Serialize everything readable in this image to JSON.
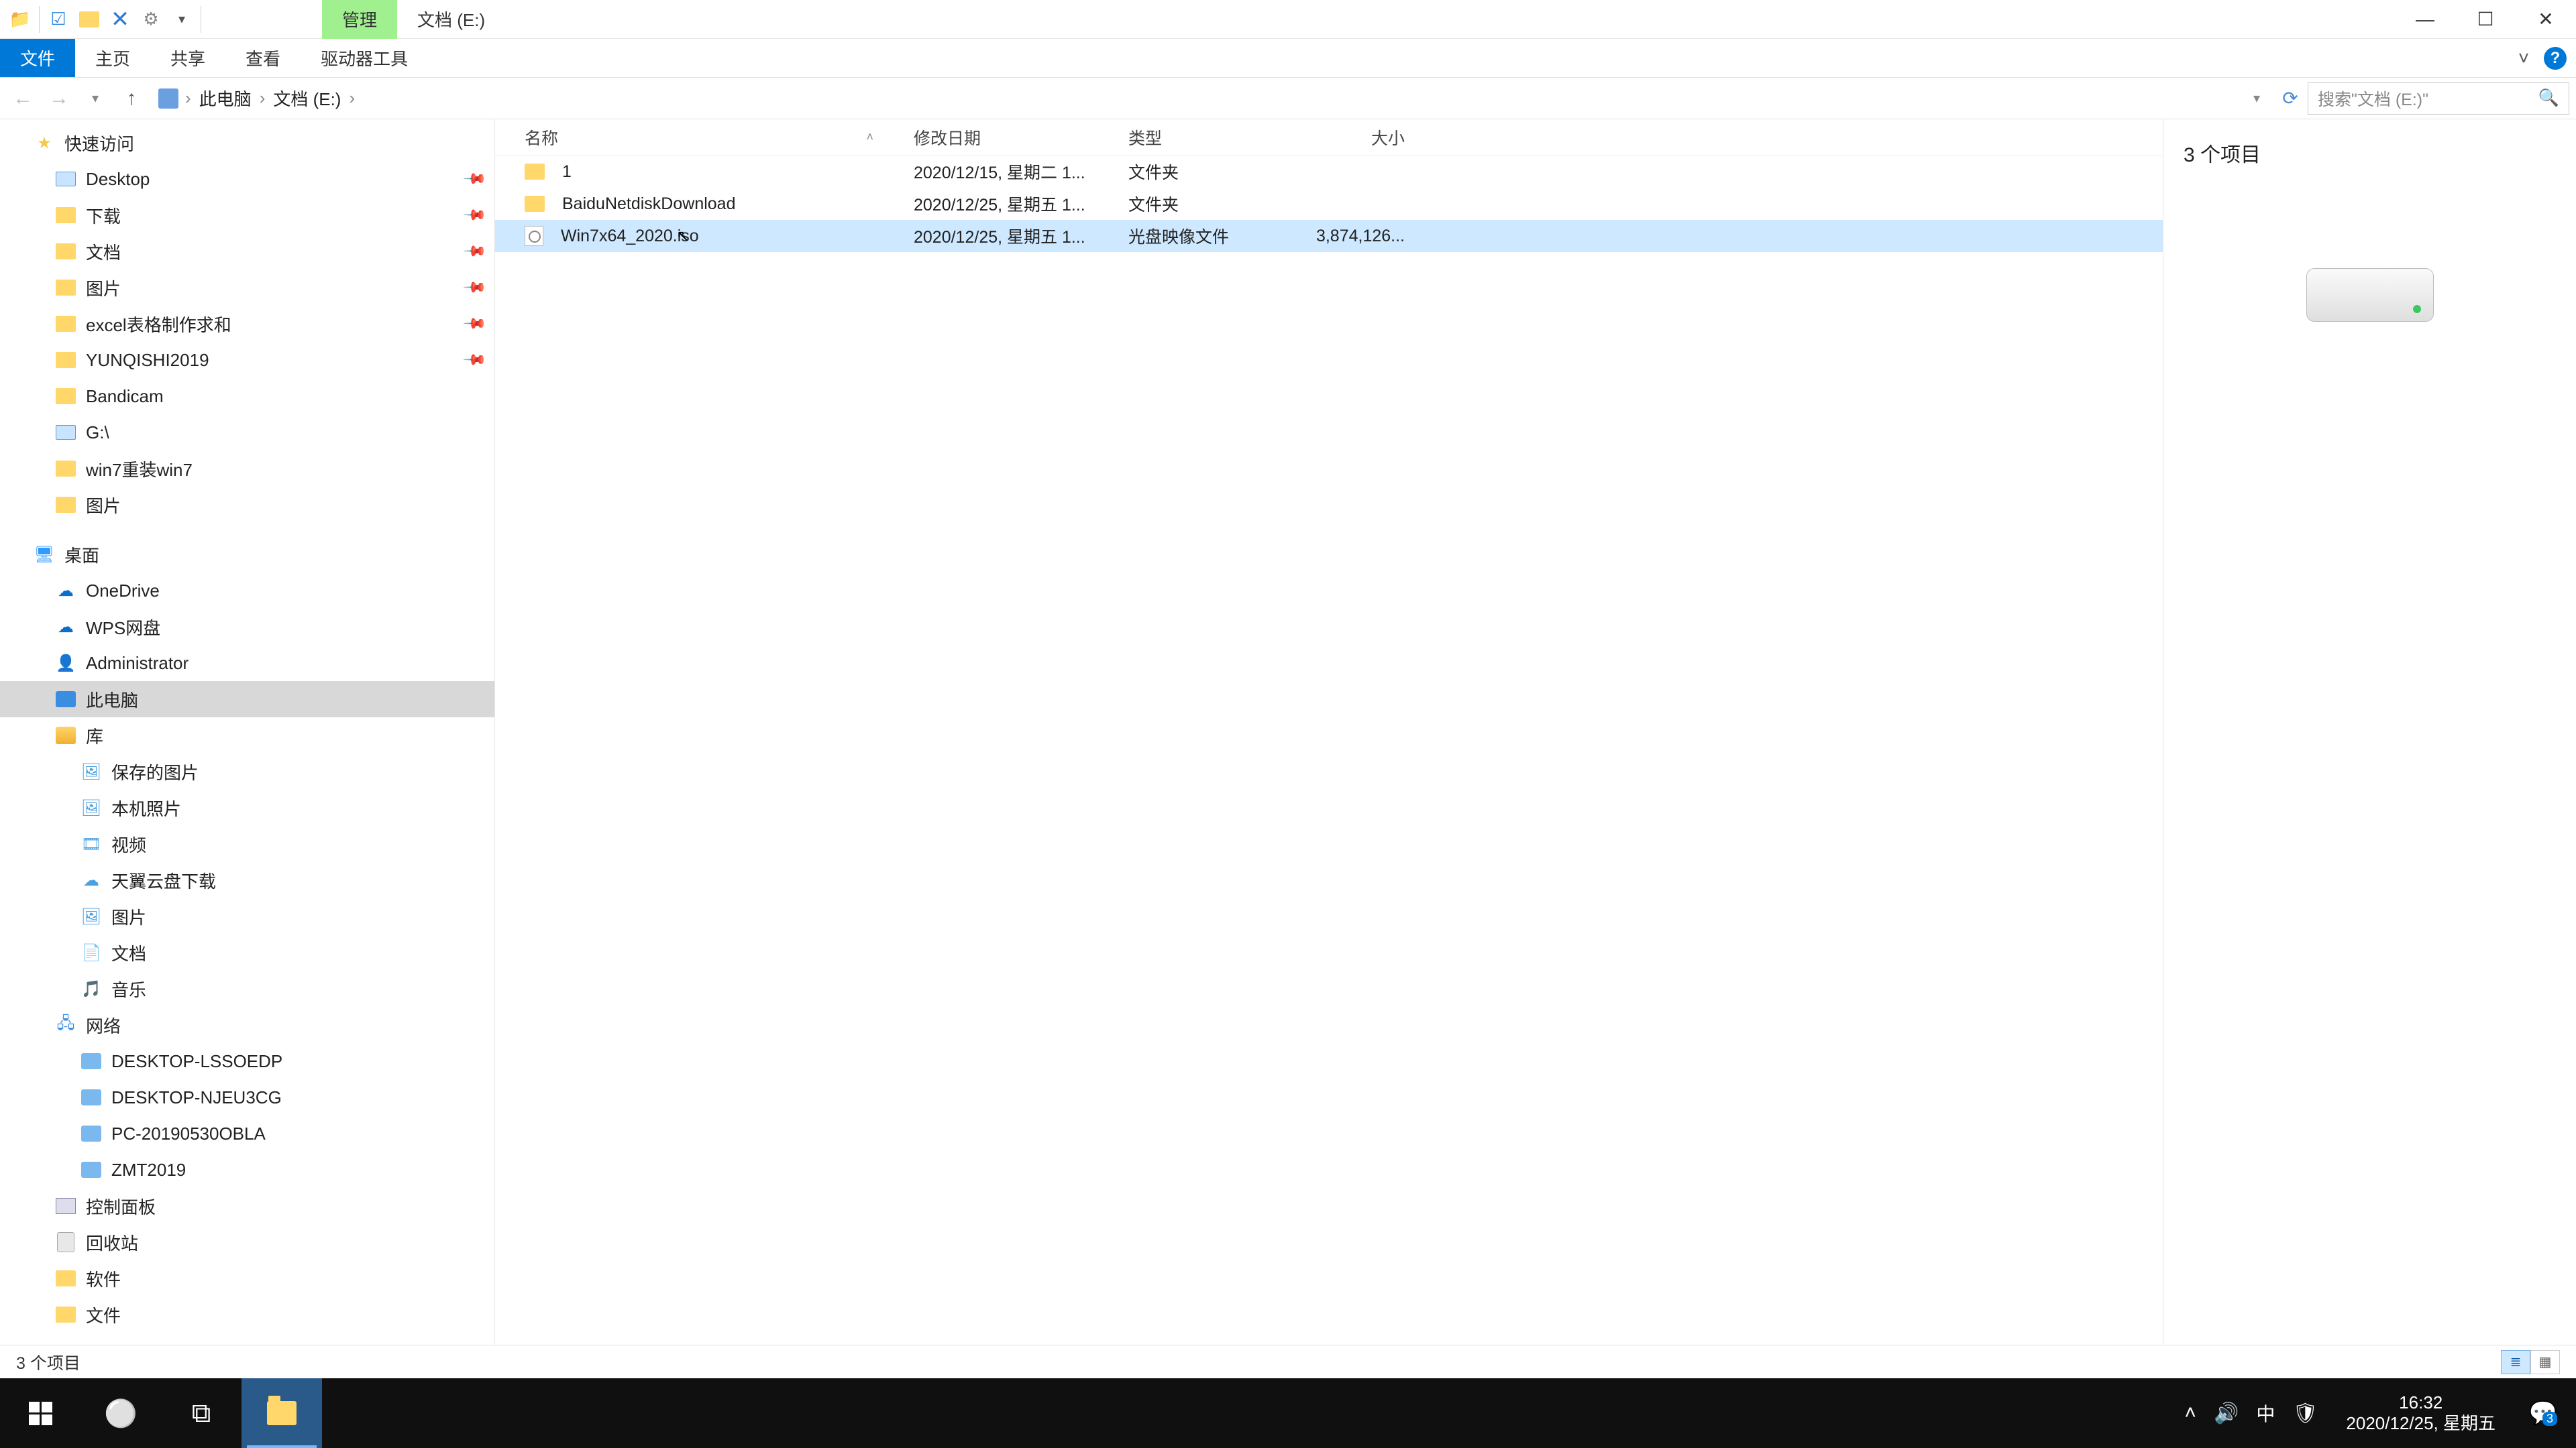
{
  "titlebar": {
    "context_tab": "管理",
    "title_tab": "文档 (E:)"
  },
  "ribbon": {
    "file": "文件",
    "tabs": [
      "主页",
      "共享",
      "查看",
      "驱动器工具"
    ]
  },
  "breadcrumb": {
    "items": [
      "此电脑",
      "文档 (E:)"
    ]
  },
  "search": {
    "placeholder": "搜索\"文档 (E:)\""
  },
  "sidebar": {
    "quick_access": "快速访问",
    "qa_items": [
      {
        "label": "Desktop",
        "icon": "drive",
        "pinned": true
      },
      {
        "label": "下载",
        "icon": "folder",
        "pinned": true
      },
      {
        "label": "文档",
        "icon": "folder",
        "pinned": true
      },
      {
        "label": "图片",
        "icon": "folder",
        "pinned": true
      },
      {
        "label": "excel表格制作求和",
        "icon": "folder",
        "pinned": true
      },
      {
        "label": "YUNQISHI2019",
        "icon": "folder",
        "pinned": true
      },
      {
        "label": "Bandicam",
        "icon": "folder",
        "pinned": false
      },
      {
        "label": "G:\\",
        "icon": "drive",
        "pinned": false
      },
      {
        "label": "win7重装win7",
        "icon": "folder",
        "pinned": false
      },
      {
        "label": "图片",
        "icon": "folder",
        "pinned": false
      }
    ],
    "desktop": "桌面",
    "desktop_items": [
      {
        "label": "OneDrive",
        "icon": "onedrive"
      },
      {
        "label": "WPS网盘",
        "icon": "onedrive"
      },
      {
        "label": "Administrator",
        "icon": "user"
      },
      {
        "label": "此电脑",
        "icon": "pc",
        "selected": true
      },
      {
        "label": "库",
        "icon": "lib"
      }
    ],
    "lib_items": [
      "保存的图片",
      "本机照片",
      "视频",
      "天翼云盘下载",
      "图片",
      "文档",
      "音乐"
    ],
    "network": "网络",
    "net_items": [
      "DESKTOP-LSSOEDP",
      "DESKTOP-NJEU3CG",
      "PC-20190530OBLA",
      "ZMT2019"
    ],
    "control_panel": "控制面板",
    "recycle": "回收站",
    "software": "软件",
    "docs": "文件"
  },
  "columns": {
    "name": "名称",
    "date": "修改日期",
    "type": "类型",
    "size": "大小"
  },
  "files": [
    {
      "name": "1",
      "date": "2020/12/15, 星期二 1...",
      "type": "文件夹",
      "size": "",
      "icon": "folder"
    },
    {
      "name": "BaiduNetdiskDownload",
      "date": "2020/12/25, 星期五 1...",
      "type": "文件夹",
      "size": "",
      "icon": "folder"
    },
    {
      "name": "Win7x64_2020.iso",
      "date": "2020/12/25, 星期五 1...",
      "type": "光盘映像文件",
      "size": "3,874,126...",
      "icon": "iso",
      "selected": true
    }
  ],
  "preview": {
    "title": "3 个项目"
  },
  "status": {
    "text": "3 个项目"
  },
  "taskbar": {
    "ime": "中",
    "time": "16:32",
    "date": "2020/12/25, 星期五",
    "notif_count": "3"
  }
}
